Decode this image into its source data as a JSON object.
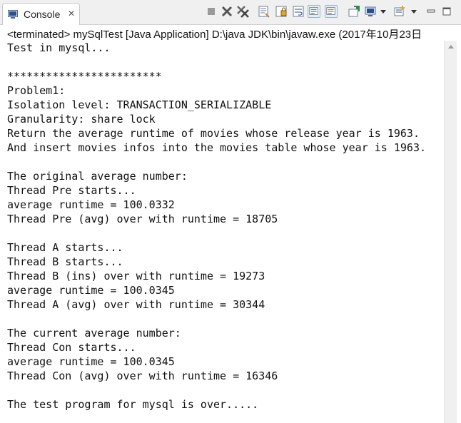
{
  "tab": {
    "title": "Console",
    "icon": "console-icon",
    "close": "✕"
  },
  "toolbar": {
    "icons": [
      "terminate-icon",
      "remove-launch-icon",
      "remove-all-terminated-icon",
      "clear-console-icon",
      "scroll-lock-icon",
      "word-wrap-icon",
      "show-console-on-stdout-icon",
      "show-console-on-stderr-icon",
      "pin-console-icon",
      "display-selected-console-icon",
      "open-console-icon",
      "minimize-icon",
      "maximize-icon"
    ]
  },
  "status": "<terminated> mySqlTest [Java Application] D:\\java JDK\\bin\\javaw.exe (2017年10月23日",
  "console_lines": [
    "Test in mysql...",
    "",
    "************************",
    "Problem1:",
    "Isolation level: TRANSACTION_SERIALIZABLE",
    "Granularity: share lock",
    "Return the average runtime of movies whose release year is 1963.",
    "And insert movies infos into the movies table whose year is 1963.",
    "",
    "The original average number:",
    "Thread Pre starts...",
    "average runtime = 100.0332",
    "Thread Pre (avg) over with runtime = 18705",
    "",
    "Thread A starts...",
    "Thread B starts...",
    "Thread B (ins) over with runtime = 19273",
    "average runtime = 100.0345",
    "Thread A (avg) over with runtime = 30344",
    "",
    "The current average number:",
    "Thread Con starts...",
    "average runtime = 100.0345",
    "Thread Con (avg) over with runtime = 16346",
    "",
    "The test program for mysql is over....."
  ]
}
